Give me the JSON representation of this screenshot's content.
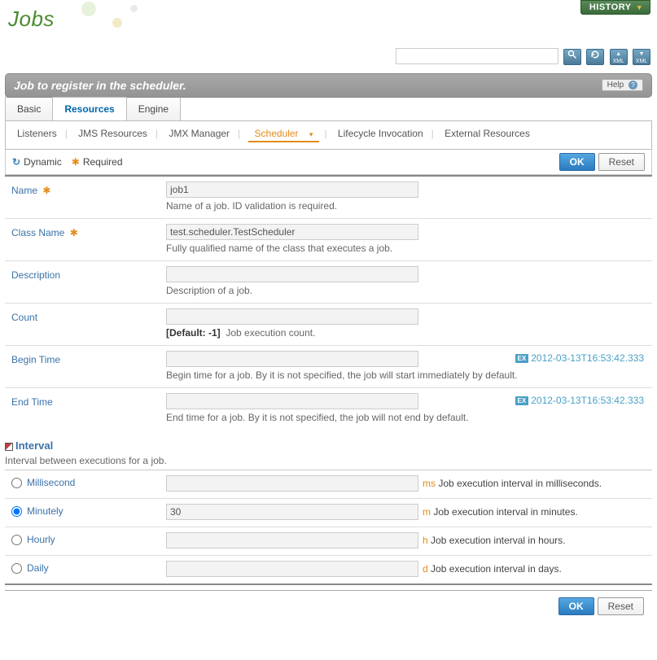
{
  "page": {
    "title": "Jobs"
  },
  "header": {
    "history_label": "HISTORY",
    "search_value": "",
    "section_title": "Job to register in the scheduler.",
    "help_label": "Help"
  },
  "tabs": {
    "main": [
      "Basic",
      "Resources",
      "Engine"
    ],
    "active_main": 1,
    "sub": [
      "Listeners",
      "JMS Resources",
      "JMX Manager",
      "Scheduler",
      "Lifecycle Invocation",
      "External Resources"
    ],
    "active_sub": 3
  },
  "legend": {
    "dynamic": "Dynamic",
    "required": "Required"
  },
  "buttons": {
    "ok": "OK",
    "reset": "Reset"
  },
  "fields": {
    "name": {
      "label": "Name",
      "value": "job1",
      "hint": "Name of a job. ID validation is required."
    },
    "className": {
      "label": "Class Name",
      "value": "test.scheduler.TestScheduler",
      "hint": "Fully qualified name of the class that executes a job."
    },
    "description": {
      "label": "Description",
      "value": "",
      "hint": "Description of a job."
    },
    "count": {
      "label": "Count",
      "value": "",
      "default_label": "[Default: -1]",
      "hint": "Job execution count."
    },
    "beginTime": {
      "label": "Begin Time",
      "value": "",
      "hint": "Begin time for a job. By it is not specified, the job will start immediately by default.",
      "example": "2012-03-13T16:53:42.333"
    },
    "endTime": {
      "label": "End Time",
      "value": "",
      "hint": "End time for a job. By it is not specified, the job will not end by default.",
      "example": "2012-03-13T16:53:42.333"
    }
  },
  "interval": {
    "title": "Interval",
    "subtitle": "Interval between executions for a job.",
    "selected": "minutely",
    "options": {
      "millisecond": {
        "label": "Millisecond",
        "value": "",
        "unit": "ms",
        "hint": "Job execution interval in milliseconds."
      },
      "minutely": {
        "label": "Minutely",
        "value": "30",
        "unit": "m",
        "hint": "Job execution interval in minutes."
      },
      "hourly": {
        "label": "Hourly",
        "value": "",
        "unit": "h",
        "hint": "Job execution interval in hours."
      },
      "daily": {
        "label": "Daily",
        "value": "",
        "unit": "d",
        "hint": "Job execution interval in days."
      }
    }
  },
  "ex_badge": "EX"
}
